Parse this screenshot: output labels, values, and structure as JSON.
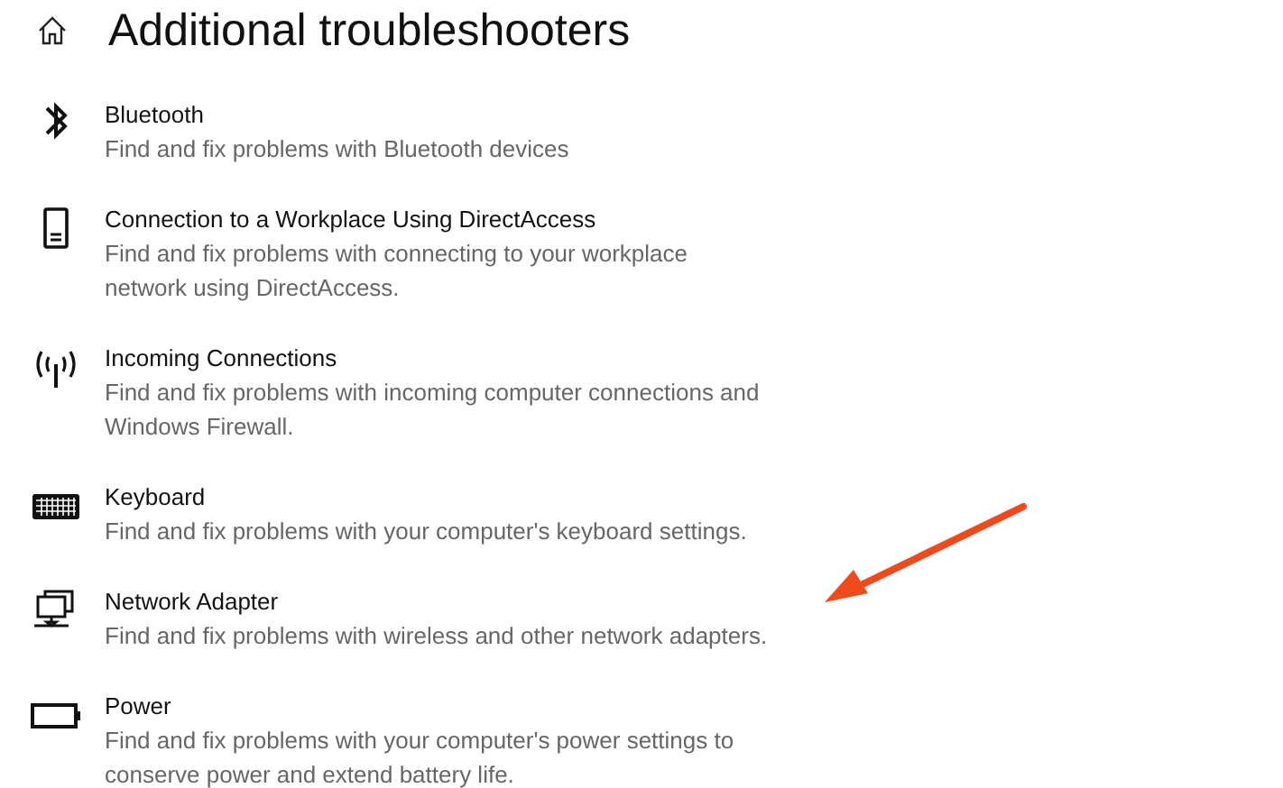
{
  "page": {
    "title": "Additional troubleshooters"
  },
  "troubleshooters": [
    {
      "kind": "bluetooth",
      "name": "Bluetooth",
      "description": "Find and fix problems with Bluetooth devices"
    },
    {
      "kind": "phone",
      "name": "Connection to a Workplace Using DirectAccess",
      "description": "Find and fix problems with connecting to your workplace\nnetwork using DirectAccess."
    },
    {
      "kind": "antenna",
      "name": "Incoming Connections",
      "description": "Find and fix problems with incoming computer connections and\nWindows Firewall."
    },
    {
      "kind": "keyboard",
      "name": "Keyboard",
      "description": "Find and fix problems with your computer's keyboard settings."
    },
    {
      "kind": "network",
      "name": "Network Adapter",
      "description": "Find and fix problems with wireless and other network adapters."
    },
    {
      "kind": "battery",
      "name": "Power",
      "description": "Find and fix problems with your computer's power settings to\nconserve power and extend battery life."
    }
  ],
  "annotations": [
    {
      "kind": "arrow"
    }
  ]
}
